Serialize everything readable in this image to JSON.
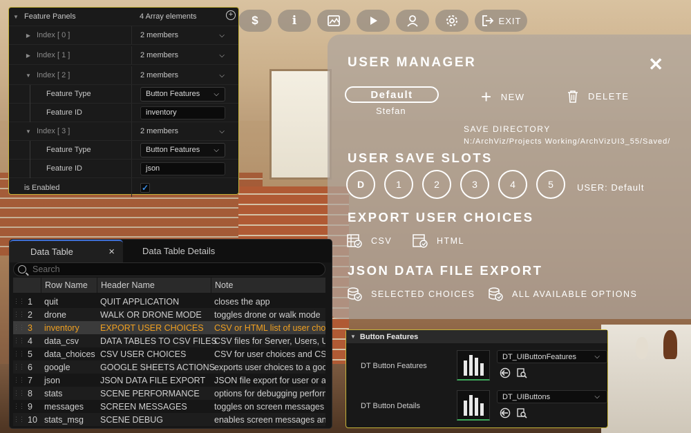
{
  "toolbar": {
    "buttons": [
      {
        "icon": "dollar-icon",
        "glyph": "$"
      },
      {
        "icon": "info-icon",
        "glyph": "i"
      },
      {
        "icon": "image-icon"
      },
      {
        "icon": "play-icon"
      },
      {
        "icon": "user-icon"
      },
      {
        "icon": "gear-icon"
      }
    ],
    "exit_label": "EXIT"
  },
  "details": {
    "feature_panels_label": "Feature Panels",
    "feature_panels_value": "4 Array elements",
    "rows": [
      {
        "index": "Index [ 0 ]",
        "value": "2 members"
      },
      {
        "index": "Index [ 1 ]",
        "value": "2 members"
      },
      {
        "index": "Index [ 2 ]",
        "value": "2 members"
      },
      {
        "index": "Index [ 3 ]",
        "value": "2 members"
      }
    ],
    "feature_type_label": "Feature Type",
    "feature_id_label": "Feature ID",
    "index2_type": "Button Features",
    "index2_id": "inventory",
    "index3_type": "Button Features",
    "index3_id": "json",
    "is_enabled_label": "is Enabled"
  },
  "user_manager": {
    "title": "USER MANAGER",
    "profile_button": "Default",
    "profile_user": "Stefan",
    "new_label": "NEW",
    "delete_label": "DELETE",
    "save_directory_label": "SAVE DIRECTORY",
    "save_directory_path": "N:/ArchViz/Projects Working/ArchVizUI3_55/Saved/",
    "save_slots_title": "USER SAVE SLOTS",
    "slots": [
      "D",
      "1",
      "2",
      "3",
      "4",
      "5"
    ],
    "slot_user": "USER: Default",
    "export_title": "EXPORT USER CHOICES",
    "csv_label": "CSV",
    "html_label": "HTML",
    "json_title": "JSON DATA FILE EXPORT",
    "selected_choices_label": "SELECTED CHOICES",
    "all_options_label": "ALL AVAILABLE OPTIONS"
  },
  "data_table": {
    "tab_active": "Data Table",
    "tab_close": "×",
    "tab_inactive": "Data Table Details",
    "search_placeholder": "Search",
    "columns": [
      "Row Name",
      "Header Name",
      "Note"
    ],
    "rows": [
      {
        "num": "1",
        "name": "quit",
        "header": "QUIT APPLICATION",
        "note": "closes the app"
      },
      {
        "num": "2",
        "name": "drone",
        "header": "WALK OR DRONE MODE",
        "note": "toggles drone or walk mode"
      },
      {
        "num": "3",
        "name": "inventory",
        "header": "EXPORT USER CHOICES",
        "note": "CSV or HTML list of user choic"
      },
      {
        "num": "4",
        "name": "data_csv",
        "header": "DATA TABLES TO CSV FILES",
        "note": "CSV files for Server, Users, Uni"
      },
      {
        "num": "5",
        "name": "data_choices",
        "header": "CSV USER CHOICES",
        "note": "CSV for user choices and CSV"
      },
      {
        "num": "6",
        "name": "google",
        "header": "GOOGLE SHEETS ACTIONS",
        "note": "exports user choices to a goo"
      },
      {
        "num": "7",
        "name": "json",
        "header": "JSON DATA FILE EXPORT",
        "note": "JSON file export for user or all"
      },
      {
        "num": "8",
        "name": "stats",
        "header": "SCENE PERFORMANCE",
        "note": "options for debugging perforn"
      },
      {
        "num": "9",
        "name": "messages",
        "header": "SCREEN MESSAGES",
        "note": "toggles on screen messages"
      },
      {
        "num": "10",
        "name": "stats_msg",
        "header": "SCENE DEBUG",
        "note": "enables screen messages and"
      }
    ],
    "selected_row": "3"
  },
  "button_features": {
    "title": "Button Features",
    "rows": [
      {
        "label": "DT Button Features",
        "asset": "DT_UIButtonFeatures"
      },
      {
        "label": "DT Button Details",
        "asset": "DT_UIButtons"
      }
    ]
  },
  "colors": {
    "panel_border": "#c5b33a",
    "selected_text": "#f0a020",
    "tab_accent": "#3e6fd4",
    "checkbox": "#3b8ee6"
  }
}
